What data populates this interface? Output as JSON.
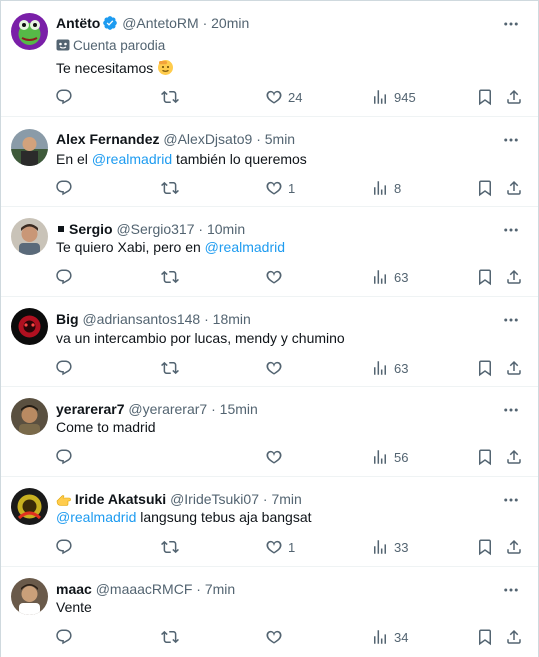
{
  "tweets": [
    {
      "display_name": "Antëto",
      "handle": "@AntetoRM",
      "time": "20min",
      "sub_label": "Cuenta parodia",
      "text_before": "Te necesitamos",
      "mention": "",
      "text_after": "",
      "replies": "",
      "retweets": "",
      "likes": "24",
      "views": "945"
    },
    {
      "display_name": "Alex Fernandez",
      "handle": "@AlexDjsato9",
      "time": "5min",
      "text_before": "En el ",
      "mention": "@realmadrid",
      "text_after": " también lo queremos",
      "replies": "",
      "retweets": "",
      "likes": "1",
      "views": "8"
    },
    {
      "display_name": "Sergio",
      "handle": "@Sergio317",
      "time": "10min",
      "text_before": "Te quiero Xabi, pero en ",
      "mention": "@realmadrid",
      "text_after": "",
      "replies": "",
      "retweets": "",
      "likes": "",
      "views": "63"
    },
    {
      "display_name": "Big",
      "handle": "@adriansantos148",
      "time": "18min",
      "text_before": "va un intercambio por lucas, mendy y chumino",
      "mention": "",
      "text_after": "",
      "replies": "",
      "retweets": "",
      "likes": "",
      "views": "63"
    },
    {
      "display_name": "yerarerar7",
      "handle": "@yerarerar7",
      "time": "15min",
      "text_before": "Come to madrid",
      "mention": "",
      "text_after": "",
      "replies": "",
      "likes": "",
      "views": "56"
    },
    {
      "display_name": "Iride Akatsuki",
      "handle": "@IrideTsuki07",
      "time": "7min",
      "text_before": "",
      "mention": "@realmadrid",
      "text_after": " langsung tebus aja bangsat",
      "replies": "",
      "retweets": "",
      "likes": "1",
      "views": "33"
    },
    {
      "display_name": "maac",
      "handle": "@maaacRMCF",
      "time": "7min",
      "text_before": "Vente",
      "mention": "",
      "text_after": "",
      "replies": "",
      "retweets": "",
      "likes": "",
      "views": "34"
    }
  ],
  "separator": "·",
  "icons": {
    "reply": "reply-icon",
    "retweet": "retweet-icon",
    "like": "heart-icon",
    "views": "views-icon",
    "bookmark": "bookmark-icon",
    "share": "share-icon",
    "more": "more-icon",
    "verified": "verified-badge-icon",
    "parody": "parody-mask-icon"
  },
  "colors": {
    "mention": "#1d9bf0",
    "secondary_text": "#536471",
    "verified": "#1d9bf0",
    "divider": "#eff3f4"
  }
}
